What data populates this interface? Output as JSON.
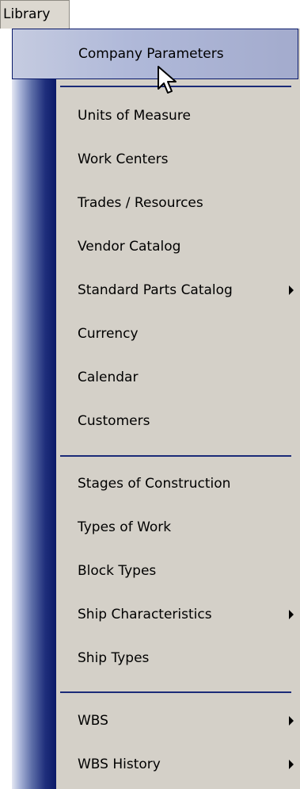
{
  "menubar": {
    "title": "Library"
  },
  "menu": {
    "items": [
      {
        "label": "Company Parameters",
        "highlighted": true,
        "submenu": false
      },
      {
        "label": "Units of Measure",
        "submenu": false
      },
      {
        "label": "Work Centers",
        "submenu": false
      },
      {
        "label": "Trades / Resources",
        "submenu": false
      },
      {
        "label": "Vendor Catalog",
        "submenu": false
      },
      {
        "label": "Standard Parts Catalog",
        "submenu": true
      },
      {
        "label": "Currency",
        "submenu": false
      },
      {
        "label": "Calendar",
        "submenu": false
      },
      {
        "label": "Customers",
        "submenu": false
      },
      {
        "label": "Stages of Construction",
        "submenu": false
      },
      {
        "label": "Types of Work",
        "submenu": false
      },
      {
        "label": "Block Types",
        "submenu": false
      },
      {
        "label": "Ship Characteristics",
        "submenu": true
      },
      {
        "label": "Ship Types",
        "submenu": false
      },
      {
        "label": "WBS",
        "submenu": true
      },
      {
        "label": "WBS History",
        "submenu": true
      }
    ]
  },
  "colors": {
    "highlight_border": "#0a1a6a",
    "gutter_dark": "#0b1a68",
    "menu_background": "#d4d0c8"
  },
  "icons": {
    "submenu": "triangle-right-icon",
    "cursor": "mouse-pointer-icon"
  }
}
